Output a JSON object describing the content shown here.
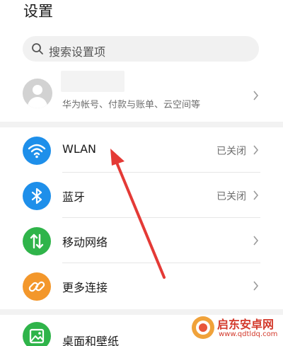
{
  "header": {
    "title": "设置"
  },
  "search": {
    "placeholder": "搜索设置项",
    "icon": "search-icon"
  },
  "account": {
    "subtitle": "华为帐号、付款与账单、云空间等"
  },
  "items": [
    {
      "label": "WLAN",
      "value": "已关闭",
      "icon": "wifi-icon",
      "color": "#1e8fea"
    },
    {
      "label": "蓝牙",
      "value": "已关闭",
      "icon": "bluetooth-icon",
      "color": "#1e8fea"
    },
    {
      "label": "移动网络",
      "value": "",
      "icon": "mobile-network-icon",
      "color": "#2fb44a"
    },
    {
      "label": "更多连接",
      "value": "",
      "icon": "link-icon",
      "color": "#f3972b"
    },
    {
      "label": "桌面和壁纸",
      "value": "",
      "icon": "wallpaper-icon",
      "color": "#2fb44a"
    }
  ],
  "annotation": {
    "arrow_color": "#e43a36"
  },
  "watermark": {
    "text": "启东安卓网",
    "url": "www.qdtldq.com"
  }
}
